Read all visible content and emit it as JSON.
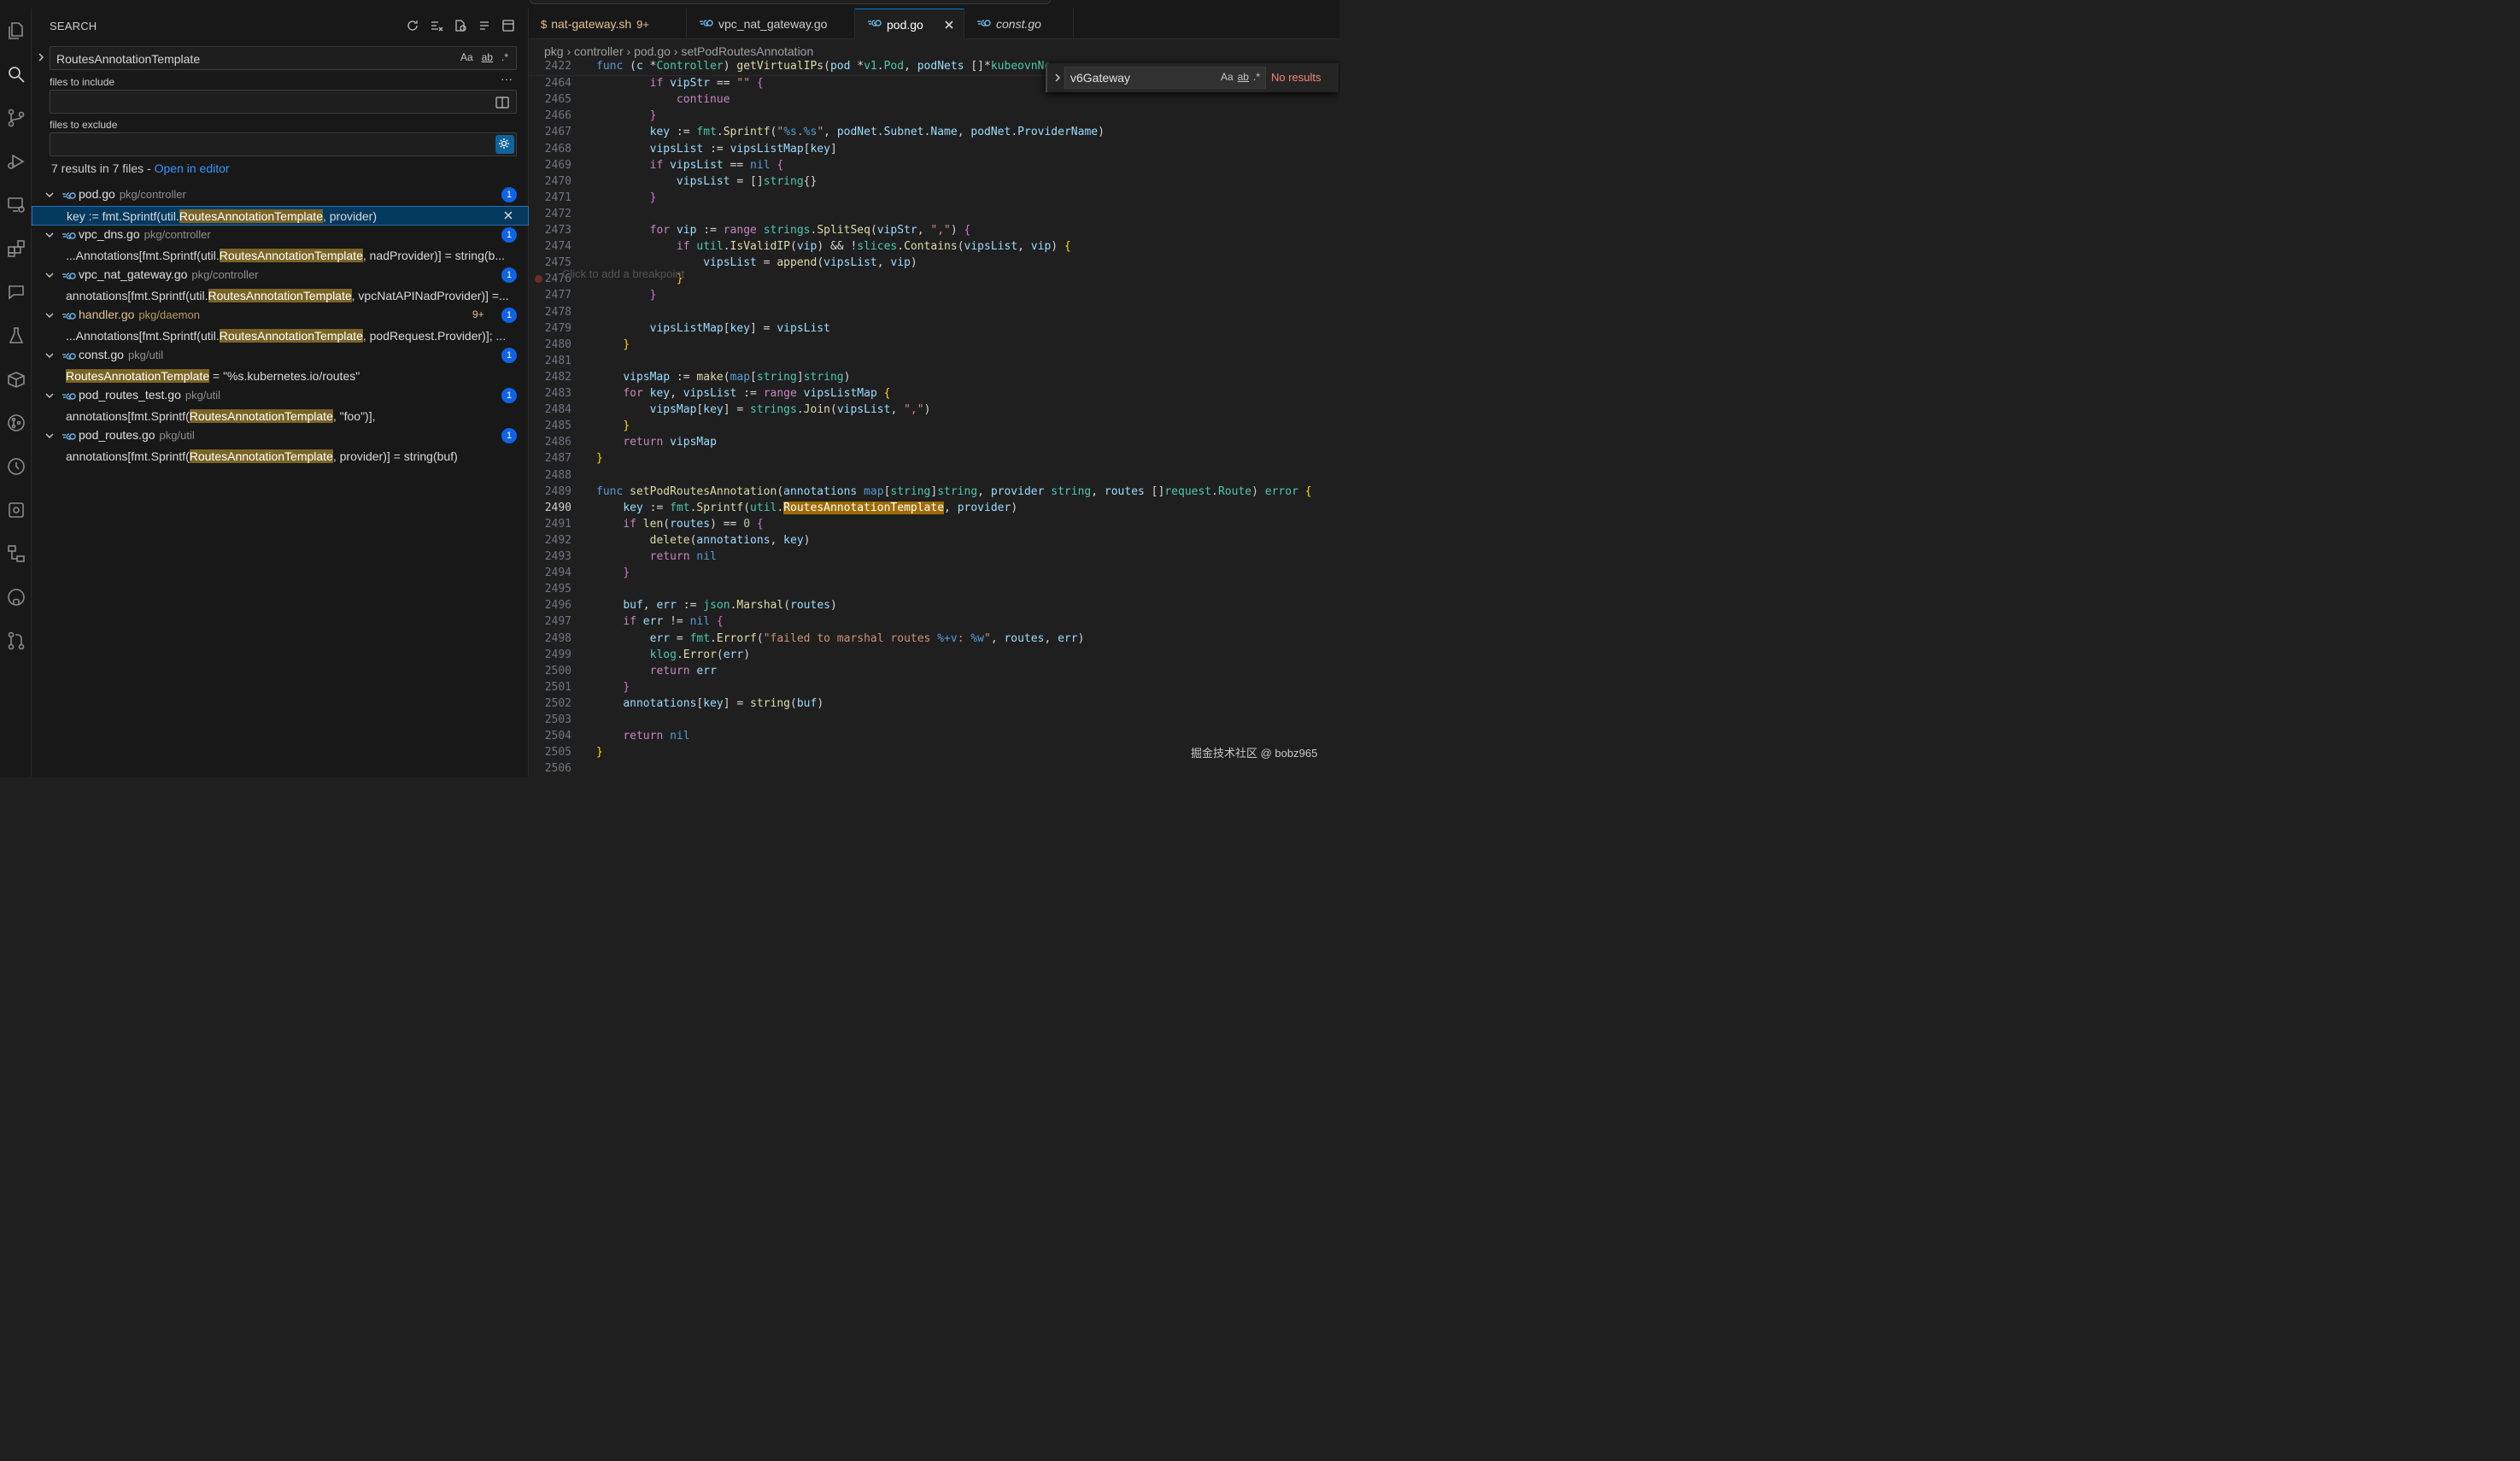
{
  "sidebar": {
    "title": "SEARCH",
    "query": "RoutesAnnotationTemplate",
    "query_opts": [
      "Aa",
      "ab",
      ".*"
    ],
    "files_include_label": "files to include",
    "files_include_value": "",
    "files_exclude_label": "files to exclude",
    "files_exclude_value": "",
    "more": "···",
    "summary": "7 results in 7 files - ",
    "open_in_editor": "Open in editor",
    "results": [
      {
        "file": "pod.go",
        "path": "pkg/controller",
        "count": "1",
        "modified": false,
        "extra": "",
        "pre": "key := fmt.Sprintf(util.",
        "hit": "RoutesAnnotationTemplate",
        "post": ", provider)",
        "selected": true
      },
      {
        "file": "vpc_dns.go",
        "path": "pkg/controller",
        "count": "1",
        "modified": false,
        "extra": "",
        "pre": "...Annotations[fmt.Sprintf(util.",
        "hit": "RoutesAnnotationTemplate",
        "post": ", nadProvider)] = string(b...",
        "selected": false
      },
      {
        "file": "vpc_nat_gateway.go",
        "path": "pkg/controller",
        "count": "1",
        "modified": false,
        "extra": "",
        "pre": "annotations[fmt.Sprintf(util.",
        "hit": "RoutesAnnotationTemplate",
        "post": ", vpcNatAPINadProvider)] =...",
        "selected": false
      },
      {
        "file": "handler.go",
        "path": "pkg/daemon",
        "count": "1",
        "modified": true,
        "extra": "9+",
        "pre": "...Annotations[fmt.Sprintf(util.",
        "hit": "RoutesAnnotationTemplate",
        "post": ", podRequest.Provider)]; ...",
        "selected": false
      },
      {
        "file": "const.go",
        "path": "pkg/util",
        "count": "1",
        "modified": false,
        "extra": "",
        "pre": "",
        "hit": "RoutesAnnotationTemplate",
        "post": "        = \"%s.kubernetes.io/routes\"",
        "selected": false
      },
      {
        "file": "pod_routes_test.go",
        "path": "pkg/util",
        "count": "1",
        "modified": false,
        "extra": "",
        "pre": "annotations[fmt.Sprintf(",
        "hit": "RoutesAnnotationTemplate",
        "post": ", \"foo\")],",
        "selected": false
      },
      {
        "file": "pod_routes.go",
        "path": "pkg/util",
        "count": "1",
        "modified": false,
        "extra": "",
        "pre": "annotations[fmt.Sprintf(",
        "hit": "RoutesAnnotationTemplate",
        "post": ", provider)] = string(buf)",
        "selected": false
      }
    ]
  },
  "tabs": [
    {
      "label": "nat-gateway.sh",
      "icon": "$",
      "suffix": "9+",
      "color": "#e2c08d",
      "active": false,
      "italic": false
    },
    {
      "label": "vpc_nat_gateway.go",
      "icon": "go-icon",
      "suffix": "",
      "color": "#cccccc",
      "active": false,
      "italic": false
    },
    {
      "label": "pod.go",
      "icon": "go-icon",
      "suffix": "",
      "color": "#ffffff",
      "active": true,
      "italic": false
    },
    {
      "label": "const.go",
      "icon": "go-icon",
      "suffix": "",
      "color": "#cccccc",
      "active": false,
      "italic": true
    }
  ],
  "breadcrumb": [
    "pkg",
    "controller",
    "pod.go",
    "setPodRoutesAnnotation"
  ],
  "find": {
    "value": "v6Gateway",
    "opts": [
      "Aa",
      "ab",
      ".*"
    ],
    "status": "No results"
  },
  "ghost_hint": "Click to add a breakpoint",
  "watermark": "掘金技术社区 @ bobz965",
  "code": [
    {
      "n": "2422",
      "h": "<span class=\"k\">func</span> (<span class=\"v\">c</span> *<span class=\"t\">Controller</span>) <span class=\"f\">getVirtualIPs</span>(<span class=\"v\">pod</span> *<span class=\"t\">v1</span>.<span class=\"t\">Pod</span>, <span class=\"v\">podNets</span> []*<span class=\"t\">kubeovnNe</span>"
    },
    {
      "n": "2464",
      "h": "        <span class=\"c\">if</span> <span class=\"v\">vipStr</span> == <span class=\"s\">\"\"</span> <span class=\"q\">{</span>"
    },
    {
      "n": "2465",
      "h": "            <span class=\"c\">continue</span>"
    },
    {
      "n": "2466",
      "h": "        <span class=\"q\">}</span>"
    },
    {
      "n": "2467",
      "h": "        <span class=\"v\">key</span> := <span class=\"t\">fmt</span>.<span class=\"f\">Sprintf</span>(<span class=\"s\">\"<span class=\"fmt\">%s</span>.<span class=\"fmt\">%s</span>\"</span>, <span class=\"v\">podNet</span>.<span class=\"v\">Subnet</span>.<span class=\"v\">Name</span>, <span class=\"v\">podNet</span>.<span class=\"v\">ProviderName</span>)"
    },
    {
      "n": "2468",
      "h": "        <span class=\"v\">vipsList</span> := <span class=\"v\">vipsListMap</span>[<span class=\"v\">key</span>]"
    },
    {
      "n": "2469",
      "h": "        <span class=\"c\">if</span> <span class=\"v\">vipsList</span> == <span class=\"k\">nil</span> <span class=\"q\">{</span>"
    },
    {
      "n": "2470",
      "h": "            <span class=\"v\">vipsList</span> = []<span class=\"t\">string</span>{}"
    },
    {
      "n": "2471",
      "h": "        <span class=\"q\">}</span>"
    },
    {
      "n": "2472",
      "h": ""
    },
    {
      "n": "2473",
      "h": "        <span class=\"c\">for</span> <span class=\"v\">vip</span> := <span class=\"c\">range</span> <span class=\"t\">strings</span>.<span class=\"f\">SplitSeq</span>(<span class=\"v\">vipStr</span>, <span class=\"s\">\",\"</span>) <span class=\"q\">{</span>"
    },
    {
      "n": "2474",
      "h": "            <span class=\"c\">if</span> <span class=\"t\">util</span>.<span class=\"f\">IsValidIP</span>(<span class=\"v\">vip</span>) && !<span class=\"t\">slices</span>.<span class=\"f\">Contains</span>(<span class=\"v\">vipsList</span>, <span class=\"v\">vip</span>) <span class=\"p\">{</span>"
    },
    {
      "n": "2475",
      "h": "                <span class=\"v\">vipsList</span> = <span class=\"f\">append</span>(<span class=\"v\">vipsList</span>, <span class=\"v\">vip</span>)"
    },
    {
      "n": "2476",
      "h": "            <span class=\"p\">}</span>"
    },
    {
      "n": "2477",
      "h": "        <span class=\"q\">}</span>"
    },
    {
      "n": "2478",
      "h": ""
    },
    {
      "n": "2479",
      "h": "        <span class=\"v\">vipsListMap</span>[<span class=\"v\">key</span>] = <span class=\"v\">vipsList</span>"
    },
    {
      "n": "2480",
      "h": "    <span class=\"p\">}</span>"
    },
    {
      "n": "2481",
      "h": ""
    },
    {
      "n": "2482",
      "h": "    <span class=\"v\">vipsMap</span> := <span class=\"f\">make</span>(<span class=\"k\">map</span>[<span class=\"t\">string</span>]<span class=\"t\">string</span>)"
    },
    {
      "n": "2483",
      "h": "    <span class=\"c\">for</span> <span class=\"v\">key</span>, <span class=\"v\">vipsList</span> := <span class=\"c\">range</span> <span class=\"v\">vipsListMap</span> <span class=\"p\">{</span>"
    },
    {
      "n": "2484",
      "h": "        <span class=\"v\">vipsMap</span>[<span class=\"v\">key</span>] = <span class=\"t\">strings</span>.<span class=\"f\">Join</span>(<span class=\"v\">vipsList</span>, <span class=\"s\">\",\"</span>)"
    },
    {
      "n": "2485",
      "h": "    <span class=\"p\">}</span>"
    },
    {
      "n": "2486",
      "h": "    <span class=\"c\">return</span> <span class=\"v\">vipsMap</span>"
    },
    {
      "n": "2487",
      "h": "<span class=\"p\">}</span>"
    },
    {
      "n": "2488",
      "h": ""
    },
    {
      "n": "2489",
      "h": "<span class=\"k\">func</span> <span class=\"f\">setPodRoutesAnnotation</span>(<span class=\"v\">annotations</span> <span class=\"k\">map</span>[<span class=\"t\">string</span>]<span class=\"t\">string</span>, <span class=\"v\">provider</span> <span class=\"t\">string</span>, <span class=\"v\">routes</span> []<span class=\"t\">request</span>.<span class=\"t\">Route</span>) <span class=\"t\">error</span> <span class=\"p\">{</span>"
    },
    {
      "n": "2490",
      "h": "    <span class=\"v\">key</span> := <span class=\"t\">fmt</span>.<span class=\"f\">Sprintf</span>(<span class=\"t\">util</span>.<span class=\"hlw\">RoutesAnnotationTemplate</span>, <span class=\"v\">provider</span>)",
      "cur": true
    },
    {
      "n": "2491",
      "h": "    <span class=\"c\">if</span> <span class=\"f\">len</span>(<span class=\"v\">routes</span>) == <span class=\"n\">0</span> <span class=\"q\">{</span>"
    },
    {
      "n": "2492",
      "h": "        <span class=\"f\">delete</span>(<span class=\"v\">annotations</span>, <span class=\"v\">key</span>)"
    },
    {
      "n": "2493",
      "h": "        <span class=\"c\">return</span> <span class=\"k\">nil</span>"
    },
    {
      "n": "2494",
      "h": "    <span class=\"q\">}</span>"
    },
    {
      "n": "2495",
      "h": ""
    },
    {
      "n": "2496",
      "h": "    <span class=\"v\">buf</span>, <span class=\"v\">err</span> := <span class=\"t\">json</span>.<span class=\"f\">Marshal</span>(<span class=\"v\">routes</span>)"
    },
    {
      "n": "2497",
      "h": "    <span class=\"c\">if</span> <span class=\"v\">err</span> != <span class=\"k\">nil</span> <span class=\"q\">{</span>"
    },
    {
      "n": "2498",
      "h": "        <span class=\"v\">err</span> = <span class=\"t\">fmt</span>.<span class=\"f\">Errorf</span>(<span class=\"s\">\"failed to marshal routes <span class=\"fmt\">%+v</span>: <span class=\"fmt\">%w</span>\"</span>, <span class=\"v\">routes</span>, <span class=\"v\">err</span>)"
    },
    {
      "n": "2499",
      "h": "        <span class=\"t\">klog</span>.<span class=\"f\">Error</span>(<span class=\"v\">err</span>)"
    },
    {
      "n": "2500",
      "h": "        <span class=\"c\">return</span> <span class=\"v\">err</span>"
    },
    {
      "n": "2501",
      "h": "    <span class=\"q\">}</span>"
    },
    {
      "n": "2502",
      "h": "    <span class=\"v\">annotations</span>[<span class=\"v\">key</span>] = <span class=\"f\">string</span>(<span class=\"v\">buf</span>)"
    },
    {
      "n": "2503",
      "h": ""
    },
    {
      "n": "2504",
      "h": "    <span class=\"c\">return</span> <span class=\"k\">nil</span>"
    },
    {
      "n": "2505",
      "h": "<span class=\"p\">}</span>"
    },
    {
      "n": "2506",
      "h": ""
    }
  ]
}
